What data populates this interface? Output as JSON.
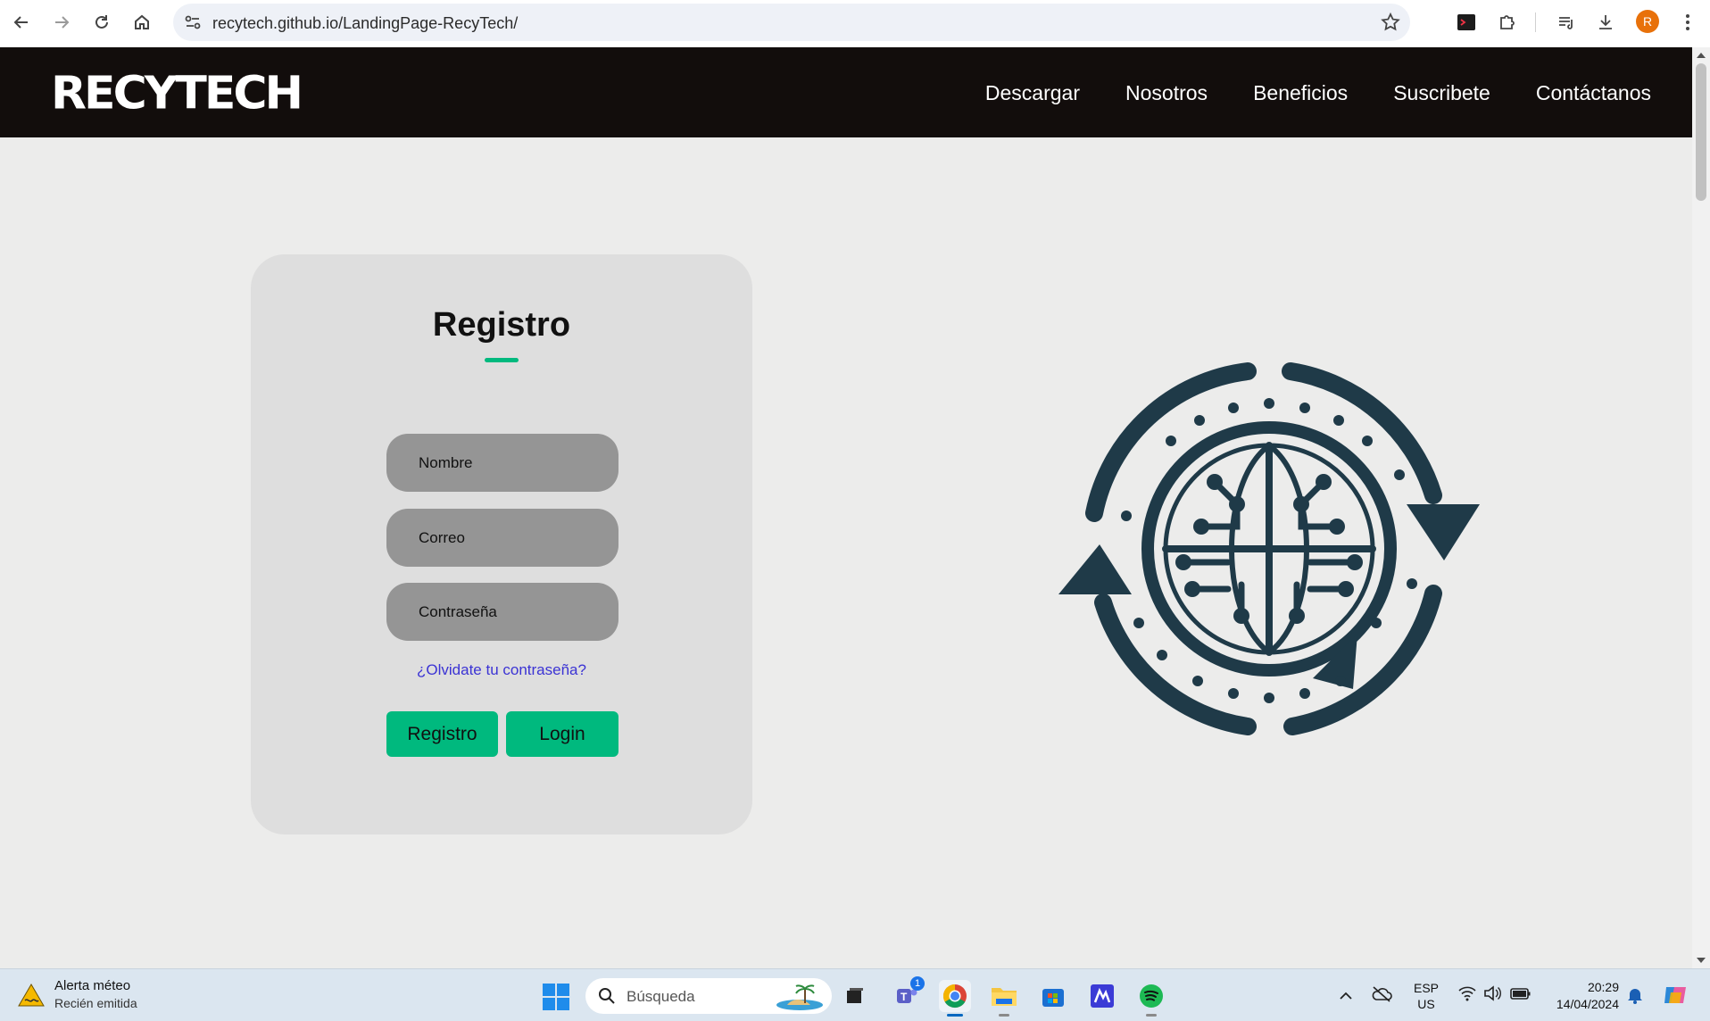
{
  "browser": {
    "url": "recytech.github.io/LandingPage-RecyTech/",
    "profile_initial": "R"
  },
  "site": {
    "logo": "RECYTECH",
    "nav": [
      "Descargar",
      "Nosotros",
      "Beneficios",
      "Suscribete",
      "Contáctanos"
    ]
  },
  "register": {
    "title": "Registro",
    "name_placeholder": "Nombre",
    "email_placeholder": "Correo",
    "password_placeholder": "Contraseña",
    "forgot_link": "¿Olvidate tu contraseña?",
    "register_button": "Registro",
    "login_button": "Login"
  },
  "taskbar": {
    "weather_title": "Alerta méteo",
    "weather_subtitle": "Recién emitida",
    "search_placeholder": "Búsqueda",
    "teams_badge": "1",
    "lang_line1": "ESP",
    "lang_line2": "US",
    "time": "20:29",
    "date": "14/04/2024"
  },
  "colors": {
    "accent_green": "#00b97e",
    "header_bg": "#120d0c",
    "illustration": "#1f3a48",
    "link": "#3b33d4"
  }
}
